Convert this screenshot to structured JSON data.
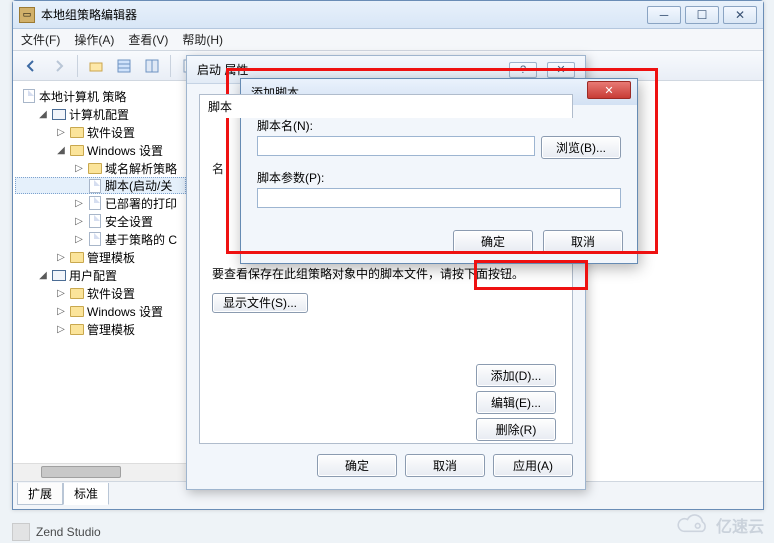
{
  "outerWindow": {
    "title": "本地组策略编辑器",
    "menus": [
      "文件(F)",
      "操作(A)",
      "查看(V)",
      "帮助(H)"
    ]
  },
  "tree": {
    "root": "本地计算机 策略",
    "items": [
      {
        "level": 2,
        "exp": "◢",
        "icon": "pc",
        "label": "计算机配置"
      },
      {
        "level": 3,
        "exp": "▷",
        "icon": "folder",
        "label": "软件设置"
      },
      {
        "level": 3,
        "exp": "◢",
        "icon": "folder",
        "label": "Windows 设置"
      },
      {
        "level": 4,
        "exp": "▷",
        "icon": "folder",
        "label": "域名解析策略"
      },
      {
        "level": 4,
        "exp": "",
        "icon": "doc",
        "label": "脚本(启动/关",
        "selected": true
      },
      {
        "level": 4,
        "exp": "▷",
        "icon": "doc",
        "label": "已部署的打印"
      },
      {
        "level": 4,
        "exp": "▷",
        "icon": "doc",
        "label": "安全设置"
      },
      {
        "level": 4,
        "exp": "▷",
        "icon": "doc",
        "label": "基于策略的 C"
      },
      {
        "level": 3,
        "exp": "▷",
        "icon": "folder",
        "label": "管理模板"
      },
      {
        "level": 2,
        "exp": "◢",
        "icon": "pc",
        "label": "用户配置"
      },
      {
        "level": 3,
        "exp": "▷",
        "icon": "folder",
        "label": "软件设置"
      },
      {
        "level": 3,
        "exp": "▷",
        "icon": "folder",
        "label": "Windows 设置"
      },
      {
        "level": 3,
        "exp": "▷",
        "icon": "folder",
        "label": "管理模板"
      }
    ]
  },
  "propWindow": {
    "title": "启动 属性",
    "tab": "脚本",
    "rowLabel": "名",
    "buttons": {
      "add": "添加(D)...",
      "edit": "编辑(E)...",
      "remove": "删除(R)"
    },
    "message": "要查看保存在此组策略对象中的脚本文件，请按下面按钮。",
    "showFiles": "显示文件(S)...",
    "ok": "确定",
    "cancel": "取消",
    "apply": "应用(A)"
  },
  "dialog": {
    "title": "添加脚本",
    "scriptNameLabel": "脚本名(N):",
    "scriptName": "",
    "browse": "浏览(B)...",
    "paramsLabel": "脚本参数(P):",
    "params": "",
    "ok": "确定",
    "cancel": "取消"
  },
  "statusTabs": {
    "ext": "扩展",
    "std": "标准"
  },
  "taskbar": {
    "label": "Zend Studio"
  },
  "watermark": "亿速云"
}
